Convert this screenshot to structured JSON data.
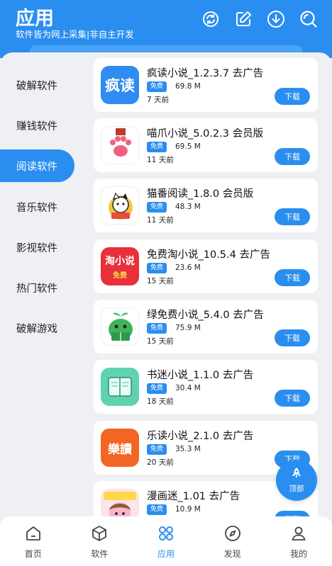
{
  "header": {
    "title": "应用",
    "subtitle": "软件皆为网上采集|非自主开发",
    "icons": [
      "refresh-icon",
      "edit-icon",
      "download-icon",
      "search-icon"
    ]
  },
  "sidebar": {
    "items": [
      {
        "label": "破解软件",
        "active": false
      },
      {
        "label": "赚钱软件",
        "active": false
      },
      {
        "label": "阅读软件",
        "active": true
      },
      {
        "label": "音乐软件",
        "active": false
      },
      {
        "label": "影视软件",
        "active": false
      },
      {
        "label": "热门软件",
        "active": false
      },
      {
        "label": "破解游戏",
        "active": false
      }
    ]
  },
  "apps": [
    {
      "name": "疯读小说_1.2.3.7 去广告",
      "badge": "免费",
      "size": "69.8 M",
      "date": "7 天前",
      "download": "下载",
      "icon": "fengdu-icon",
      "icon_text": "疯读"
    },
    {
      "name": "喵爪小说_5.0.2.3 会员版",
      "badge": "免费",
      "size": "69.5 M",
      "date": "11 天前",
      "download": "下载",
      "icon": "cat-paw-icon"
    },
    {
      "name": "猫番阅读_1.8.0 会员版",
      "badge": "免费",
      "size": "48.3 M",
      "date": "11 天前",
      "download": "下载",
      "icon": "cat-reading-icon"
    },
    {
      "name": "免费淘小说_10.5.4 去广告",
      "badge": "免费",
      "size": "23.6 M",
      "date": "15 天前",
      "download": "下载",
      "icon": "taoxiaoshuo-icon",
      "icon_text": "淘小说",
      "icon_sub": "免费"
    },
    {
      "name": "绿免费小说_5.4.0 去广告",
      "badge": "免费",
      "size": "75.9 M",
      "date": "15 天前",
      "download": "下载",
      "icon": "green-book-icon"
    },
    {
      "name": "书迷小说_1.1.0 去广告",
      "badge": "免费",
      "size": "30.4 M",
      "date": "18 天前",
      "download": "下载",
      "icon": "open-book-icon"
    },
    {
      "name": "乐读小说_2.1.0 去广告",
      "badge": "免费",
      "size": "35.3 M",
      "date": "20 天前",
      "download": "下载",
      "icon": "ledu-icon",
      "icon_text": "樂讀"
    },
    {
      "name": "漫画迷_1.01 去广告",
      "badge": "免费",
      "size": "10.9 M",
      "date": "",
      "download": "下载",
      "icon": "manga-girl-icon"
    }
  ],
  "top_button": {
    "label": "顶部",
    "icon": "rocket-icon"
  },
  "bottom_nav": [
    {
      "label": "首页",
      "icon": "home-icon",
      "active": false
    },
    {
      "label": "软件",
      "icon": "cube-icon",
      "active": false
    },
    {
      "label": "应用",
      "icon": "apps-icon",
      "active": true
    },
    {
      "label": "发现",
      "icon": "compass-icon",
      "active": false
    },
    {
      "label": "我的",
      "icon": "user-icon",
      "active": false
    }
  ],
  "colors": {
    "accent": "#2a8ef0",
    "background": "#eef0f3",
    "card": "#ffffff"
  }
}
